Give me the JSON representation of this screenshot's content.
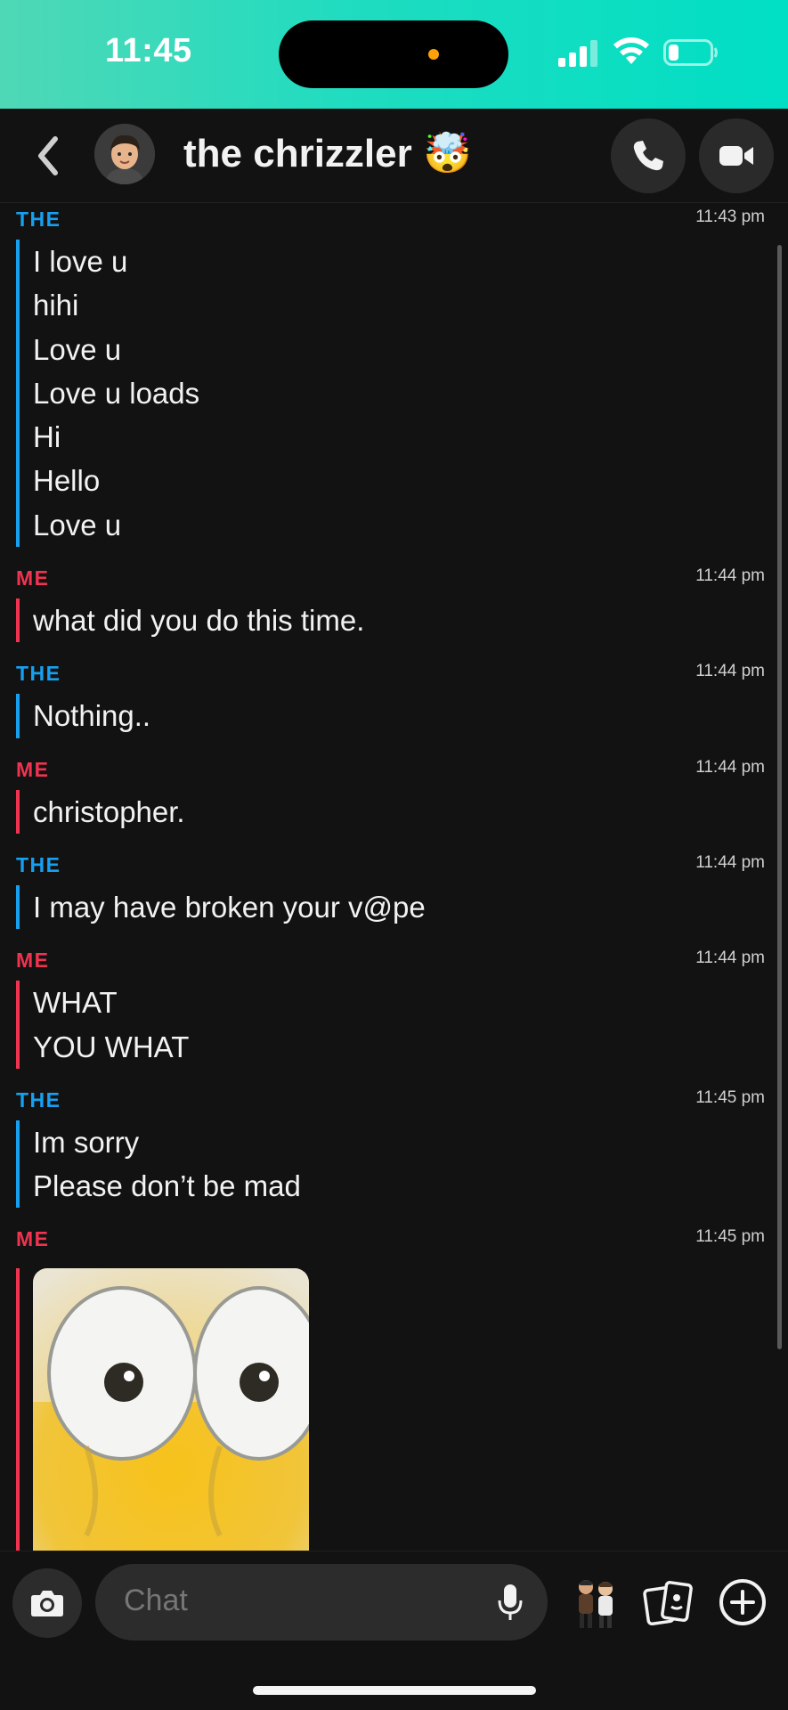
{
  "status_bar": {
    "time": "11:45",
    "icons": [
      "cellular-signal-icon",
      "wifi-icon",
      "battery-icon"
    ]
  },
  "header": {
    "title": "the chrizzler 🤯",
    "icons": [
      "back-chevron-icon",
      "avatar",
      "phone-icon",
      "video-camera-icon"
    ]
  },
  "messages": [
    {
      "sender": "THE",
      "role": "them",
      "time": "11:43 pm",
      "lines": [
        "I love u",
        "hihi",
        "Love u",
        "Love u loads",
        "Hi",
        "Hello",
        "Love u"
      ]
    },
    {
      "sender": "ME",
      "role": "me",
      "time": "11:44 pm",
      "lines": [
        "what did you do this time."
      ]
    },
    {
      "sender": "THE",
      "role": "them",
      "time": "11:44 pm",
      "lines": [
        "Nothing.."
      ]
    },
    {
      "sender": "ME",
      "role": "me",
      "time": "11:44 pm",
      "lines": [
        "christopher."
      ]
    },
    {
      "sender": "THE",
      "role": "them",
      "time": "11:44 pm",
      "lines": [
        "I may have broken your v@pe"
      ]
    },
    {
      "sender": "ME",
      "role": "me",
      "time": "11:44 pm",
      "lines": [
        "WHAT",
        "YOU WHAT"
      ]
    },
    {
      "sender": "THE",
      "role": "them",
      "time": "11:45 pm",
      "lines": [
        "Im sorry",
        "Please don’t be mad"
      ]
    },
    {
      "sender": "ME",
      "role": "me",
      "time": "11:45 pm",
      "lines": [],
      "attachment": "image"
    }
  ],
  "input_bar": {
    "placeholder": "Chat",
    "icons": [
      "camera-icon",
      "microphone-icon",
      "bitmoji-icon",
      "cards-icon",
      "plus-icon"
    ]
  },
  "colors": {
    "them": "#18a0f0",
    "me": "#f0334f",
    "background": "#121212",
    "status_gradient_end": "#00dfc4"
  }
}
